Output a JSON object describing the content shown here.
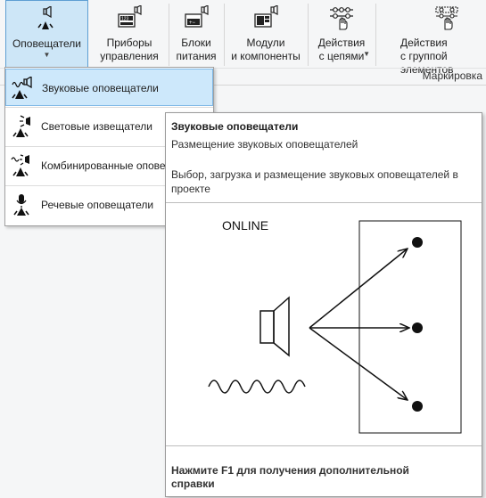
{
  "ribbon": {
    "buttons": [
      {
        "label": "Оповещатели",
        "has_dropdown": true,
        "active": true
      },
      {
        "label": "Приборы\nуправления"
      },
      {
        "label": "Блоки\nпитания"
      },
      {
        "label": "Модули\nи компоненты"
      },
      {
        "label": "Действия\nс цепями",
        "has_dropdown": true
      },
      {
        "label": "Действия\nс группой элементов"
      }
    ],
    "group_label": "Маркировка"
  },
  "menu": {
    "items": [
      {
        "label": "Звуковые оповещатели",
        "icon": "sound-alarm-icon",
        "highlighted": true
      },
      {
        "label": "Световые извещатели",
        "icon": "light-alarm-icon"
      },
      {
        "label": "Комбинированные оповещатели",
        "icon": "combined-alarm-icon"
      },
      {
        "label": "Речевые оповещатели",
        "icon": "voice-alarm-icon"
      }
    ]
  },
  "tooltip": {
    "title": "Звуковые оповещатели",
    "subtitle": "Размещение звуковых оповещателей",
    "description": "Выбор, загрузка и размещение звуковых оповещателей в проекте",
    "image_caption": "ONLINE",
    "footer": "Нажмите F1 для получения дополнительной справки"
  },
  "colors": {
    "ribbon_bg": "#f5f6f7",
    "active_bg": "#cde6f7",
    "active_border": "#5e9fd3",
    "highlight_bg": "#cde8fb"
  }
}
